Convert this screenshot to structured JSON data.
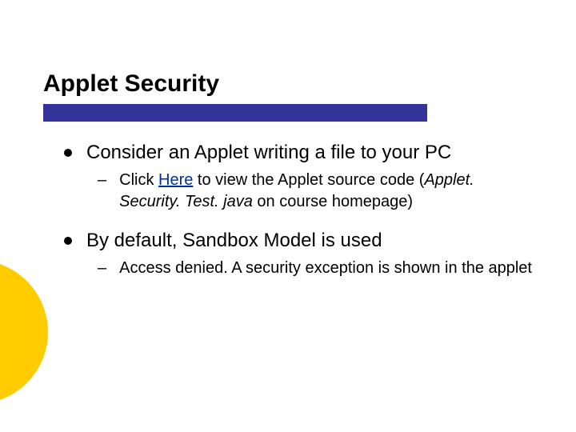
{
  "title": "Applet Security",
  "bullets": {
    "b1": {
      "text": "Consider an Applet writing a file to your PC"
    },
    "b1_sub": {
      "pre": "Click ",
      "link": "Here",
      "mid": " to view the Applet source code (",
      "italic": "Applet. Security. Test. java",
      "post": " on course homepage)"
    },
    "b2": {
      "text": "By default, Sandbox Model is used"
    },
    "b2_sub": {
      "text": "Access denied. A security exception is shown in the applet"
    }
  }
}
